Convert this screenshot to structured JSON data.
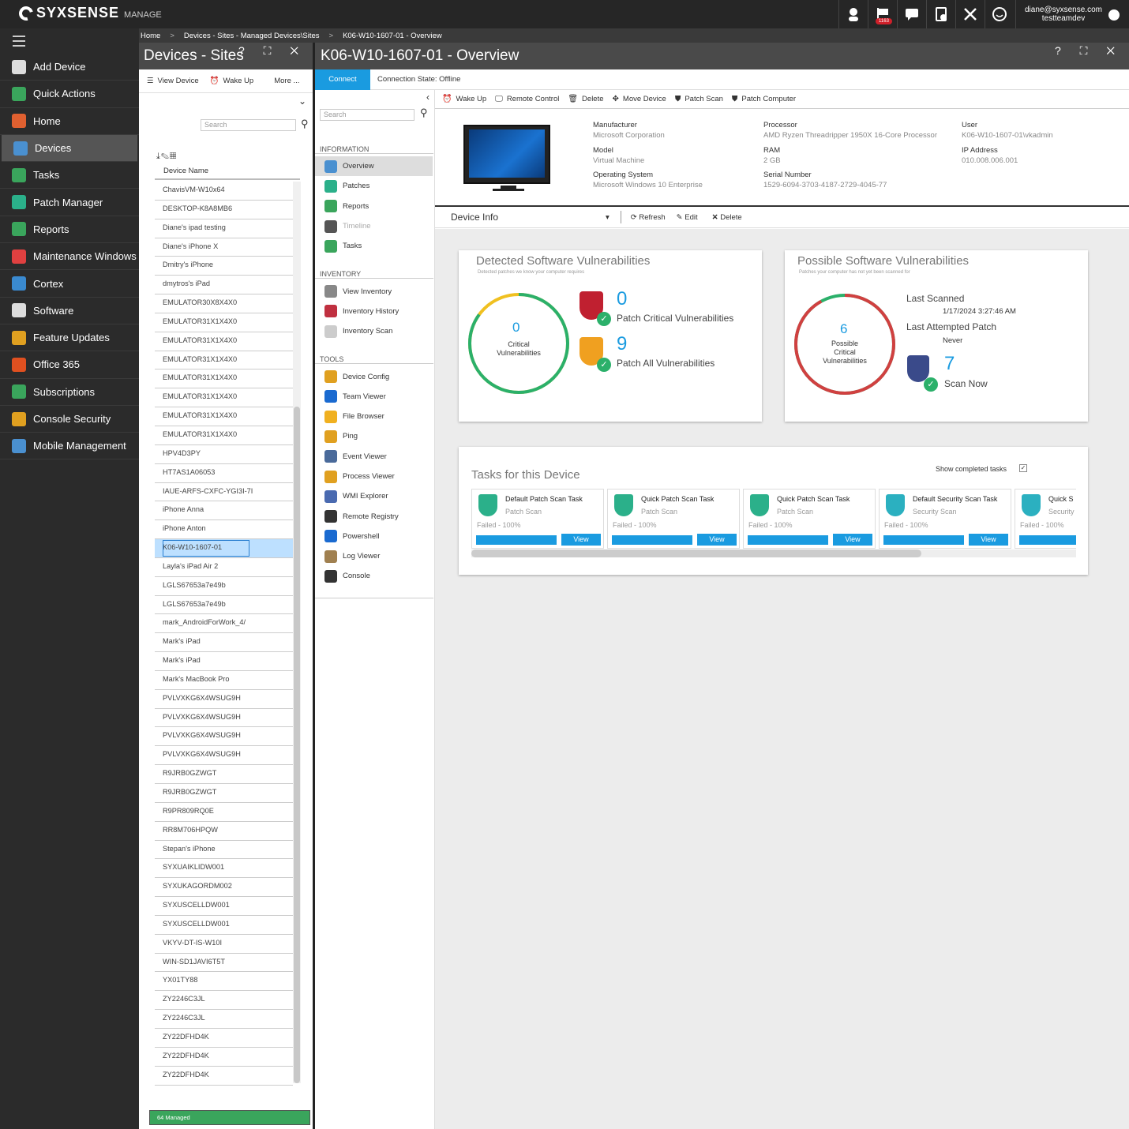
{
  "topbar": {
    "brand": "SYXSENSE",
    "brand_sub": "MANAGE",
    "notif_count": "1163",
    "user_email": "diane@syxsense.com",
    "user_org": "testteamdev",
    "icons": [
      "support-icon",
      "flag-icon",
      "chat-icon",
      "clipboard-icon",
      "tools-icon",
      "smiley-icon"
    ]
  },
  "sidebar": {
    "items": [
      {
        "label": "Add Device",
        "icon": "add-device-icon",
        "color": "#dddddd"
      },
      {
        "label": "Quick Actions",
        "icon": "plus-icon",
        "color": "#3aa55c"
      },
      {
        "label": "Home",
        "icon": "home-icon",
        "color": "#e06030"
      },
      {
        "label": "Devices",
        "icon": "monitor-icon",
        "color": "#4a90d0"
      },
      {
        "label": "Tasks",
        "icon": "tasks-icon",
        "color": "#3aa55c"
      },
      {
        "label": "Patch Manager",
        "icon": "shield-icon",
        "color": "#2bb08a"
      },
      {
        "label": "Reports",
        "icon": "reports-icon",
        "color": "#3aa55c"
      },
      {
        "label": "Maintenance Windows",
        "icon": "wrench-icon",
        "color": "#e04040"
      },
      {
        "label": "Cortex",
        "icon": "cortex-icon",
        "color": "#3a8ad0"
      },
      {
        "label": "Software",
        "icon": "software-icon",
        "color": "#dddddd"
      },
      {
        "label": "Feature Updates",
        "icon": "windows-icon",
        "color": "#e0a020"
      },
      {
        "label": "Office 365",
        "icon": "office-icon",
        "color": "#e05020"
      },
      {
        "label": "Subscriptions",
        "icon": "subscriptions-icon",
        "color": "#3aa55c"
      },
      {
        "label": "Console Security",
        "icon": "lock-icon",
        "color": "#e0a020"
      },
      {
        "label": "Mobile Management",
        "icon": "mobile-icon",
        "color": "#4a90d0"
      }
    ]
  },
  "breadcrumb": {
    "home": "Home",
    "sites": "Devices - Sites - Managed Devices\\Sites",
    "device": "K06-W10-1607-01 - Overview",
    "sep": ">"
  },
  "devices_panel": {
    "title": "Devices - Sites",
    "controls": "? ⛶ ✕",
    "view_device": "View Device",
    "wake_up": "Wake Up",
    "more": "More ...",
    "search_placeholder": "Search",
    "col_device_name": "Device Name",
    "managed": "64 Managed",
    "devices": [
      "ChavisVM-W10x64",
      "DESKTOP-K8A8MB6",
      "Diane's ipad testing",
      "Diane's iPhone X",
      "Dmitry's iPhone",
      "dmytros's iPad",
      "EMULATOR30X8X4X0",
      "EMULATOR31X1X4X0",
      "EMULATOR31X1X4X0",
      "EMULATOR31X1X4X0",
      "EMULATOR31X1X4X0",
      "EMULATOR31X1X4X0",
      "EMULATOR31X1X4X0",
      "EMULATOR31X1X4X0",
      "HPV4D3PY",
      "HT7AS1A06053",
      "IAUE-ARFS-CXFC-YGI3I-7I",
      "iPhone Anna",
      "iPhone Anton",
      "K06-W10-1607-01",
      "Layla's iPad Air 2",
      "LGLS67653a7e49b",
      "LGLS67653a7e49b",
      "mark_AndroidForWork_4/",
      "Mark's iPad",
      "Mark's iPad",
      "Mark's MacBook Pro",
      "PVLVXKG6X4WSUG9H",
      "PVLVXKG6X4WSUG9H",
      "PVLVXKG6X4WSUG9H",
      "PVLVXKG6X4WSUG9H",
      "R9JRB0GZWGT",
      "R9JRB0GZWGT",
      "R9PR809RQ0E",
      "RR8M706HPQW",
      "Stepan's iPhone",
      "SYXUAIKLIDW001",
      "SYXUKAGORDM002",
      "SYXUSCELLDW001",
      "SYXUSCELLDW001",
      "VKYV-DT-IS-W10I",
      "WIN-SD1JAVI6T5T",
      "YX01TY88",
      "ZY2246C3JL",
      "ZY2246C3JL",
      "ZY22DFHD4K",
      "ZY22DFHD4K",
      "ZY22DFHD4K"
    ],
    "selected_index": 19
  },
  "overview": {
    "title": "K06-W10-1607-01 - Overview",
    "connect": "Connect",
    "conn_state": "Connection State: Offline",
    "nav_search": "Search",
    "sections": [
      {
        "title": "INFORMATION",
        "items": [
          {
            "label": "Overview",
            "icon": "overview-icon",
            "color": "#4a90d0",
            "active": true
          },
          {
            "label": "Patches",
            "icon": "patches-icon",
            "color": "#2bb08a"
          },
          {
            "label": "Reports",
            "icon": "reports-icon",
            "color": "#3aa55c"
          },
          {
            "label": "Timeline",
            "icon": "timeline-icon",
            "color": "#555555",
            "disabled": true
          },
          {
            "label": "Tasks",
            "icon": "tasks-icon",
            "color": "#3aa55c"
          }
        ]
      },
      {
        "title": "INVENTORY",
        "items": [
          {
            "label": "View Inventory",
            "icon": "inventory-icon",
            "color": "#888888"
          },
          {
            "label": "Inventory History",
            "icon": "history-icon",
            "color": "#c03040"
          },
          {
            "label": "Inventory Scan",
            "icon": "scan-icon",
            "color": "#cccccc"
          }
        ]
      },
      {
        "title": "TOOLS",
        "items": [
          {
            "label": "Device Config",
            "icon": "config-icon",
            "color": "#e0a020"
          },
          {
            "label": "Team Viewer",
            "icon": "teamviewer-icon",
            "color": "#1a6ad0"
          },
          {
            "label": "File Browser",
            "icon": "folder-icon",
            "color": "#f0b020"
          },
          {
            "label": "Ping",
            "icon": "ping-icon",
            "color": "#e0a020"
          },
          {
            "label": "Event Viewer",
            "icon": "event-icon",
            "color": "#4a6a9a"
          },
          {
            "label": "Process Viewer",
            "icon": "process-icon",
            "color": "#e0a020"
          },
          {
            "label": "WMI Explorer",
            "icon": "wmi-icon",
            "color": "#4a6ab0"
          },
          {
            "label": "Remote Registry",
            "icon": "registry-icon",
            "color": "#333333"
          },
          {
            "label": "Powershell",
            "icon": "powershell-icon",
            "color": "#1a6ad0"
          },
          {
            "label": "Log Viewer",
            "icon": "log-icon",
            "color": "#a08050"
          },
          {
            "label": "Console",
            "icon": "console-icon",
            "color": "#333333"
          }
        ]
      }
    ],
    "actions": [
      "Wake Up",
      "Remote Control",
      "Delete",
      "Move Device",
      "Patch Scan",
      "Patch Computer"
    ],
    "info": {
      "manufacturer_label": "Manufacturer",
      "manufacturer": "Microsoft Corporation",
      "model_label": "Model",
      "model": "Virtual Machine",
      "os_label": "Operating System",
      "os": "Microsoft Windows 10 Enterprise",
      "processor_label": "Processor",
      "processor": "AMD Ryzen Threadripper 1950X 16-Core Processor",
      "ram_label": "RAM",
      "ram": "2 GB",
      "serial_label": "Serial Number",
      "serial": "1529-6094-3703-4187-2729-4045-77",
      "user_label": "User",
      "user": "K06-W10-1607-01\\vkadmin",
      "ip_label": "IP Address",
      "ip": "010.008.006.001"
    },
    "device_info": "Device Info",
    "refresh": "Refresh",
    "edit": "Edit",
    "delete": "Delete",
    "detected": {
      "title": "Detected Software Vulnerabilities",
      "subtitle": "Detected patches we know your computer requires",
      "count": "0",
      "count_label1": "Critical",
      "count_label2": "Vulnerabilities",
      "crit_count": "0",
      "crit_label": "Patch Critical Vulnerabilities",
      "all_count": "9",
      "all_label": "Patch All Vulnerabilities",
      "ring_fraction": 0.85
    },
    "possible": {
      "title": "Possible Software Vulnerabilities",
      "subtitle": "Patches your computer has not yet been scanned for",
      "count": "6",
      "count_label1": "Possible",
      "count_label2": "Critical",
      "count_label3": "Vulnerabilities",
      "last_scanned_label": "Last Scanned",
      "last_scanned": "1/17/2024 3:27:46 AM",
      "last_patch_label": "Last Attempted Patch",
      "last_patch": "Never",
      "scan_count": "7",
      "scan_label": "Scan Now",
      "ring_fraction": 0.92
    },
    "tasks": {
      "title": "Tasks for this Device",
      "show_completed": "Show completed tasks",
      "view": "View",
      "items": [
        {
          "name": "Default Patch Scan Task",
          "type": "Patch Scan",
          "status": "Failed - 100%",
          "color": "#2bb08a"
        },
        {
          "name": "Quick Patch Scan Task",
          "type": "Patch Scan",
          "status": "Failed - 100%",
          "color": "#2bb08a"
        },
        {
          "name": "Quick Patch Scan Task",
          "type": "Patch Scan",
          "status": "Failed - 100%",
          "color": "#2bb08a"
        },
        {
          "name": "Default Security Scan Task",
          "type": "Security Scan",
          "status": "Failed - 100%",
          "color": "#2bb0c0"
        },
        {
          "name": "Quick S",
          "type": "Security",
          "status": "Failed - 100%",
          "color": "#2bb0c0"
        }
      ]
    }
  }
}
